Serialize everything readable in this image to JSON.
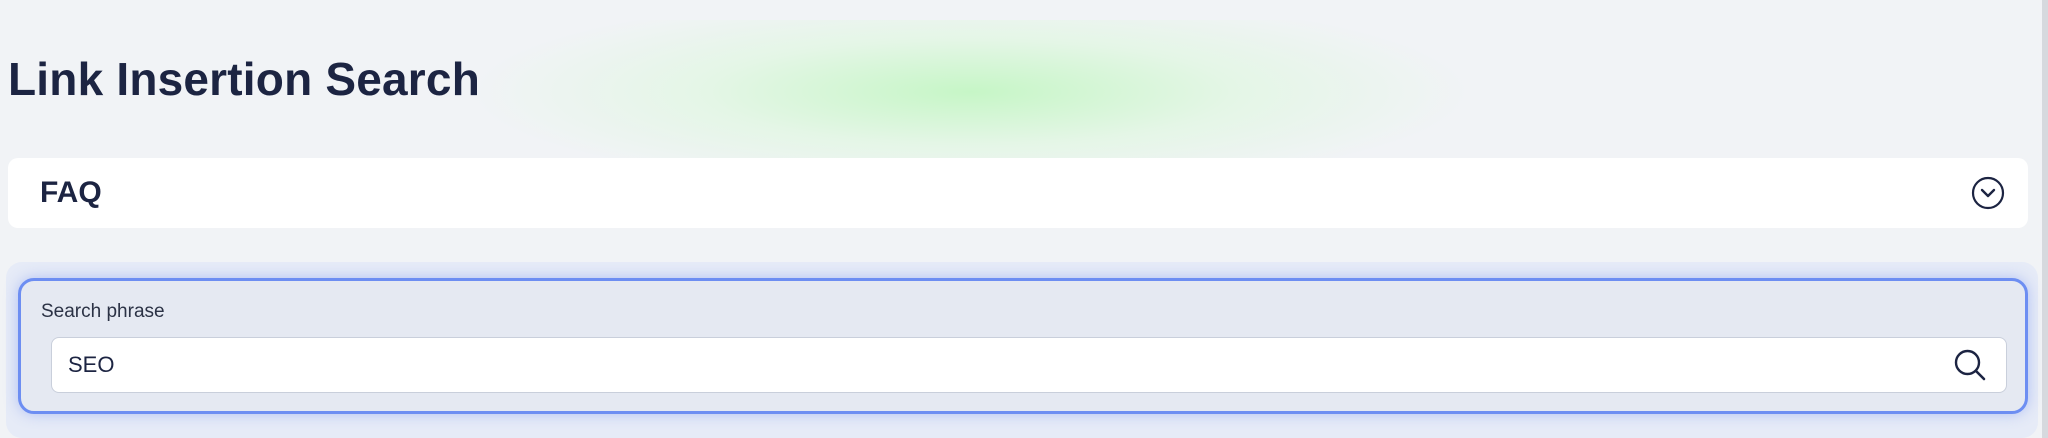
{
  "header": {
    "title": "Link Insertion Search"
  },
  "faq": {
    "label": "FAQ",
    "toggle_icon": "chevron-down-circle-icon"
  },
  "search": {
    "label": "Search phrase",
    "value": "SEO",
    "button_icon": "search-icon"
  },
  "colors": {
    "title": "#1c2442",
    "panel_border": "#6d8ef2",
    "panel_bg": "#e5e9f2",
    "glow": "#c4f6c4"
  }
}
